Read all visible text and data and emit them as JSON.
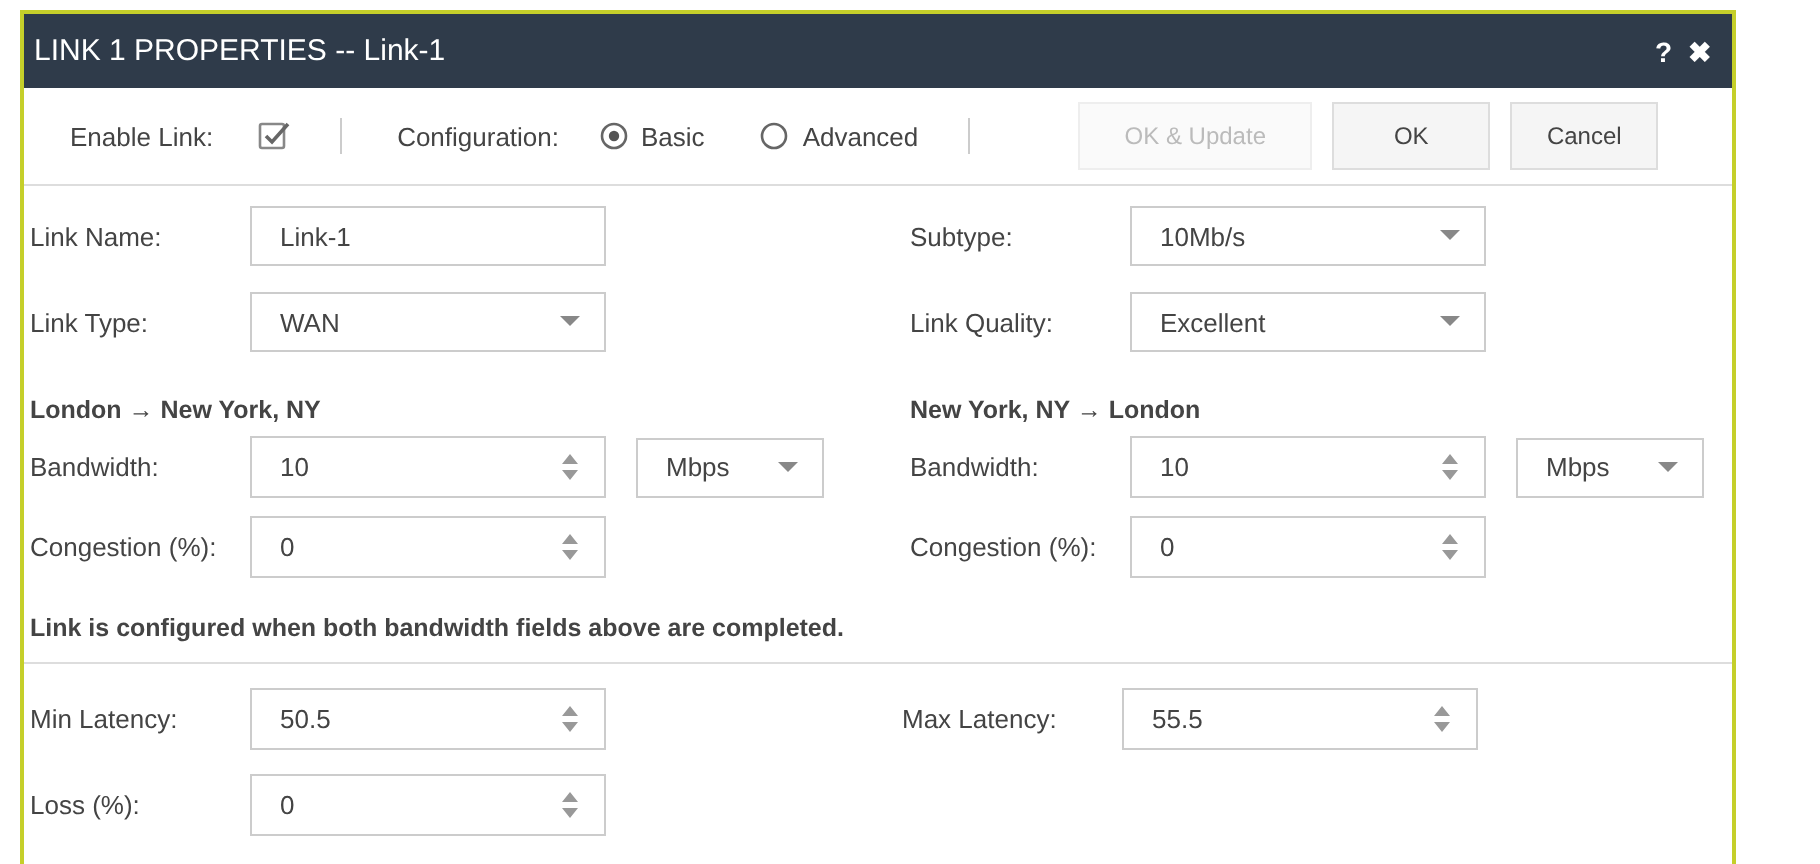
{
  "window": {
    "title": "LINK 1 PROPERTIES -- Link-1",
    "help": "?",
    "close": "✖"
  },
  "toolbar": {
    "enable_link": {
      "label": "Enable Link:",
      "checked": true
    },
    "configuration": {
      "label": "Configuration:",
      "options": [
        {
          "label": "Basic",
          "selected": true
        },
        {
          "label": "Advanced",
          "selected": false
        }
      ]
    },
    "buttons": [
      {
        "label": "OK & Update",
        "disabled": true
      },
      {
        "label": "OK",
        "disabled": false
      },
      {
        "label": "Cancel",
        "disabled": false
      }
    ]
  },
  "general_fields": [
    {
      "label": "Link Name:",
      "kind": "text",
      "value": "Link-1"
    },
    {
      "label": "Subtype:",
      "kind": "select",
      "value": "10Mb/s"
    },
    {
      "label": "Link Type:",
      "kind": "select",
      "value": "WAN"
    },
    {
      "label": "Link Quality:",
      "kind": "select",
      "value": "Excellent"
    }
  ],
  "directions": [
    {
      "heading": "London → New York, NY",
      "bandwidth": {
        "label": "Bandwidth:",
        "value": "10",
        "unit": "Mbps"
      },
      "congestion": {
        "label": "Congestion (%):",
        "value": "0"
      }
    },
    {
      "heading": "New York, NY → London",
      "bandwidth": {
        "label": "Bandwidth:",
        "value": "10",
        "unit": "Mbps"
      },
      "congestion": {
        "label": "Congestion (%):",
        "value": "0"
      }
    }
  ],
  "note": "Link is configured when both bandwidth fields above are completed.",
  "latency_fields": [
    {
      "label": "Min Latency:",
      "value": "50.5"
    },
    {
      "label": "Max Latency:",
      "value": "55.5"
    },
    {
      "label": "Loss (%):",
      "value": "0"
    }
  ]
}
